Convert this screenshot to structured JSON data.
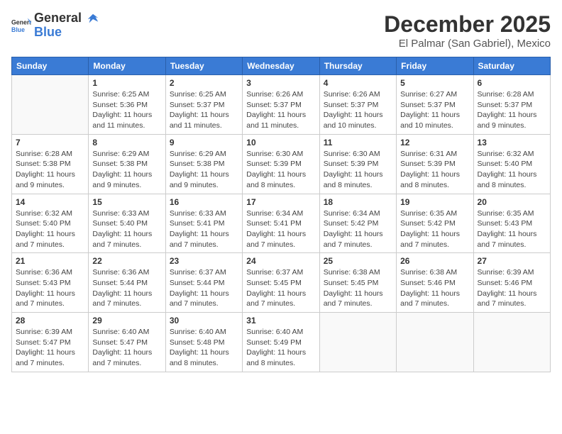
{
  "header": {
    "logo_general": "General",
    "logo_blue": "Blue",
    "month_title": "December 2025",
    "location": "El Palmar (San Gabriel), Mexico"
  },
  "weekdays": [
    "Sunday",
    "Monday",
    "Tuesday",
    "Wednesday",
    "Thursday",
    "Friday",
    "Saturday"
  ],
  "weeks": [
    [
      {
        "day": "",
        "empty": true
      },
      {
        "day": "1",
        "sunrise": "6:25 AM",
        "sunset": "5:36 PM",
        "daylight": "11 hours and 11 minutes."
      },
      {
        "day": "2",
        "sunrise": "6:25 AM",
        "sunset": "5:37 PM",
        "daylight": "11 hours and 11 minutes."
      },
      {
        "day": "3",
        "sunrise": "6:26 AM",
        "sunset": "5:37 PM",
        "daylight": "11 hours and 11 minutes."
      },
      {
        "day": "4",
        "sunrise": "6:26 AM",
        "sunset": "5:37 PM",
        "daylight": "11 hours and 10 minutes."
      },
      {
        "day": "5",
        "sunrise": "6:27 AM",
        "sunset": "5:37 PM",
        "daylight": "11 hours and 10 minutes."
      },
      {
        "day": "6",
        "sunrise": "6:28 AM",
        "sunset": "5:37 PM",
        "daylight": "11 hours and 9 minutes."
      }
    ],
    [
      {
        "day": "7",
        "sunrise": "6:28 AM",
        "sunset": "5:38 PM",
        "daylight": "11 hours and 9 minutes."
      },
      {
        "day": "8",
        "sunrise": "6:29 AM",
        "sunset": "5:38 PM",
        "daylight": "11 hours and 9 minutes."
      },
      {
        "day": "9",
        "sunrise": "6:29 AM",
        "sunset": "5:38 PM",
        "daylight": "11 hours and 9 minutes."
      },
      {
        "day": "10",
        "sunrise": "6:30 AM",
        "sunset": "5:39 PM",
        "daylight": "11 hours and 8 minutes."
      },
      {
        "day": "11",
        "sunrise": "6:30 AM",
        "sunset": "5:39 PM",
        "daylight": "11 hours and 8 minutes."
      },
      {
        "day": "12",
        "sunrise": "6:31 AM",
        "sunset": "5:39 PM",
        "daylight": "11 hours and 8 minutes."
      },
      {
        "day": "13",
        "sunrise": "6:32 AM",
        "sunset": "5:40 PM",
        "daylight": "11 hours and 8 minutes."
      }
    ],
    [
      {
        "day": "14",
        "sunrise": "6:32 AM",
        "sunset": "5:40 PM",
        "daylight": "11 hours and 7 minutes."
      },
      {
        "day": "15",
        "sunrise": "6:33 AM",
        "sunset": "5:40 PM",
        "daylight": "11 hours and 7 minutes."
      },
      {
        "day": "16",
        "sunrise": "6:33 AM",
        "sunset": "5:41 PM",
        "daylight": "11 hours and 7 minutes."
      },
      {
        "day": "17",
        "sunrise": "6:34 AM",
        "sunset": "5:41 PM",
        "daylight": "11 hours and 7 minutes."
      },
      {
        "day": "18",
        "sunrise": "6:34 AM",
        "sunset": "5:42 PM",
        "daylight": "11 hours and 7 minutes."
      },
      {
        "day": "19",
        "sunrise": "6:35 AM",
        "sunset": "5:42 PM",
        "daylight": "11 hours and 7 minutes."
      },
      {
        "day": "20",
        "sunrise": "6:35 AM",
        "sunset": "5:43 PM",
        "daylight": "11 hours and 7 minutes."
      }
    ],
    [
      {
        "day": "21",
        "sunrise": "6:36 AM",
        "sunset": "5:43 PM",
        "daylight": "11 hours and 7 minutes."
      },
      {
        "day": "22",
        "sunrise": "6:36 AM",
        "sunset": "5:44 PM",
        "daylight": "11 hours and 7 minutes."
      },
      {
        "day": "23",
        "sunrise": "6:37 AM",
        "sunset": "5:44 PM",
        "daylight": "11 hours and 7 minutes."
      },
      {
        "day": "24",
        "sunrise": "6:37 AM",
        "sunset": "5:45 PM",
        "daylight": "11 hours and 7 minutes."
      },
      {
        "day": "25",
        "sunrise": "6:38 AM",
        "sunset": "5:45 PM",
        "daylight": "11 hours and 7 minutes."
      },
      {
        "day": "26",
        "sunrise": "6:38 AM",
        "sunset": "5:46 PM",
        "daylight": "11 hours and 7 minutes."
      },
      {
        "day": "27",
        "sunrise": "6:39 AM",
        "sunset": "5:46 PM",
        "daylight": "11 hours and 7 minutes."
      }
    ],
    [
      {
        "day": "28",
        "sunrise": "6:39 AM",
        "sunset": "5:47 PM",
        "daylight": "11 hours and 7 minutes."
      },
      {
        "day": "29",
        "sunrise": "6:40 AM",
        "sunset": "5:47 PM",
        "daylight": "11 hours and 7 minutes."
      },
      {
        "day": "30",
        "sunrise": "6:40 AM",
        "sunset": "5:48 PM",
        "daylight": "11 hours and 8 minutes."
      },
      {
        "day": "31",
        "sunrise": "6:40 AM",
        "sunset": "5:49 PM",
        "daylight": "11 hours and 8 minutes."
      },
      {
        "day": "",
        "empty": true
      },
      {
        "day": "",
        "empty": true
      },
      {
        "day": "",
        "empty": true
      }
    ]
  ]
}
